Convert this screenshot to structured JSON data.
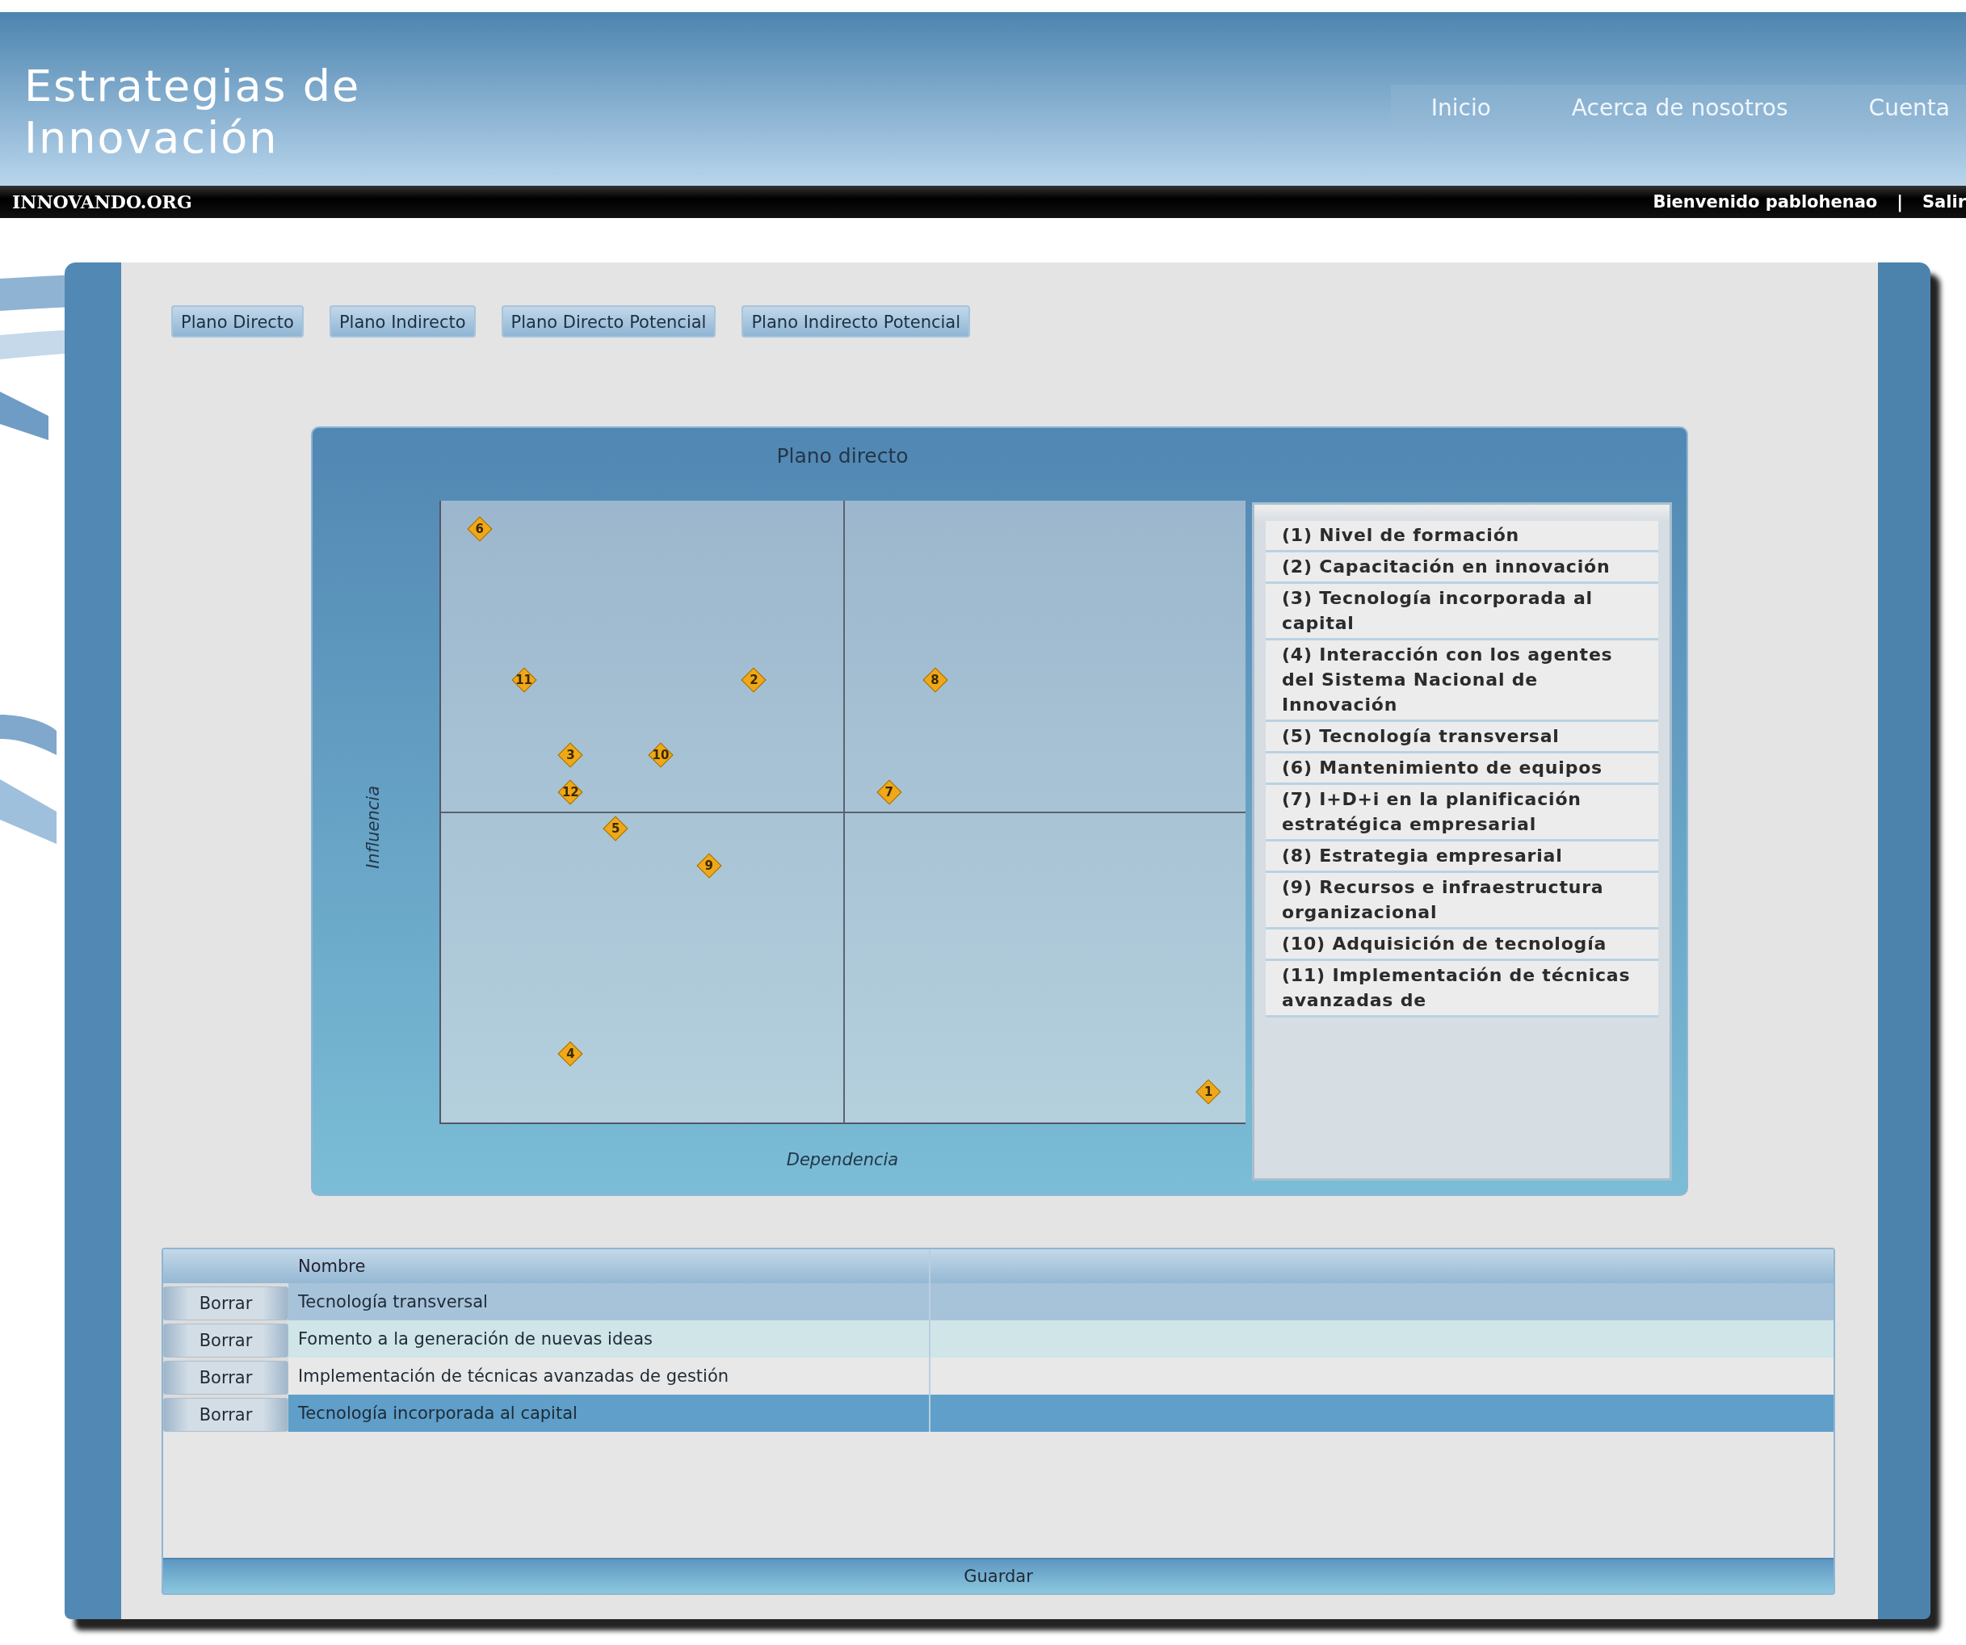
{
  "header": {
    "title_lines": [
      "Estrategias de",
      "Innovación"
    ],
    "nav": [
      {
        "label": "Inicio"
      },
      {
        "label": "Acerca de nosotros"
      },
      {
        "label": "Cuenta"
      }
    ]
  },
  "topbar": {
    "site": "INNOVANDO.ORG",
    "welcome": "Bienvenido pablohenao",
    "separator": "|",
    "logout": "Salir"
  },
  "tabs": [
    {
      "label": "Plano Directo"
    },
    {
      "label": "Plano Indirecto"
    },
    {
      "label": "Plano Directo Potencial"
    },
    {
      "label": "Plano Indirecto Potencial"
    }
  ],
  "plot": {
    "title": "Plano directo",
    "xlabel": "Dependencia",
    "ylabel": "Influencia",
    "points": [
      {
        "label": "1"
      },
      {
        "label": "2"
      },
      {
        "label": "3"
      },
      {
        "label": "4"
      },
      {
        "label": "5"
      },
      {
        "label": "6"
      },
      {
        "label": "7"
      },
      {
        "label": "8"
      },
      {
        "label": "9"
      },
      {
        "label": "10"
      },
      {
        "label": "11"
      },
      {
        "label": "12"
      }
    ],
    "legend": [
      "(1) Nivel de formación",
      "(2) Capacitación en innovación",
      "(3) Tecnología incorporada al capital",
      "(4) Interacción con los agentes del Sistema Nacional de Innovación",
      "(5) Tecnología transversal",
      "(6) Mantenimiento de equipos",
      "(7) I+D+i en la planificación estratégica empresarial",
      "(8) Estrategia empresarial",
      "(9) Recursos e infraestructura organizacional",
      "(10) Adquisición de tecnología",
      "(11) Implementación de técnicas avanzadas de"
    ]
  },
  "table": {
    "columns": [
      "Nombre"
    ],
    "rows": [
      {
        "action": "Borrar",
        "name": "Tecnología transversal",
        "hovered": true,
        "selected": false
      },
      {
        "action": "Borrar",
        "name": "Fomento a la generación de nuevas ideas",
        "hovered": false,
        "selected": false
      },
      {
        "action": "Borrar",
        "name": "Implementación de técnicas avanzadas de gestión",
        "hovered": false,
        "selected": false
      },
      {
        "action": "Borrar",
        "name": "Tecnología incorporada al capital",
        "hovered": false,
        "selected": true
      }
    ],
    "save": "Guardar"
  }
}
